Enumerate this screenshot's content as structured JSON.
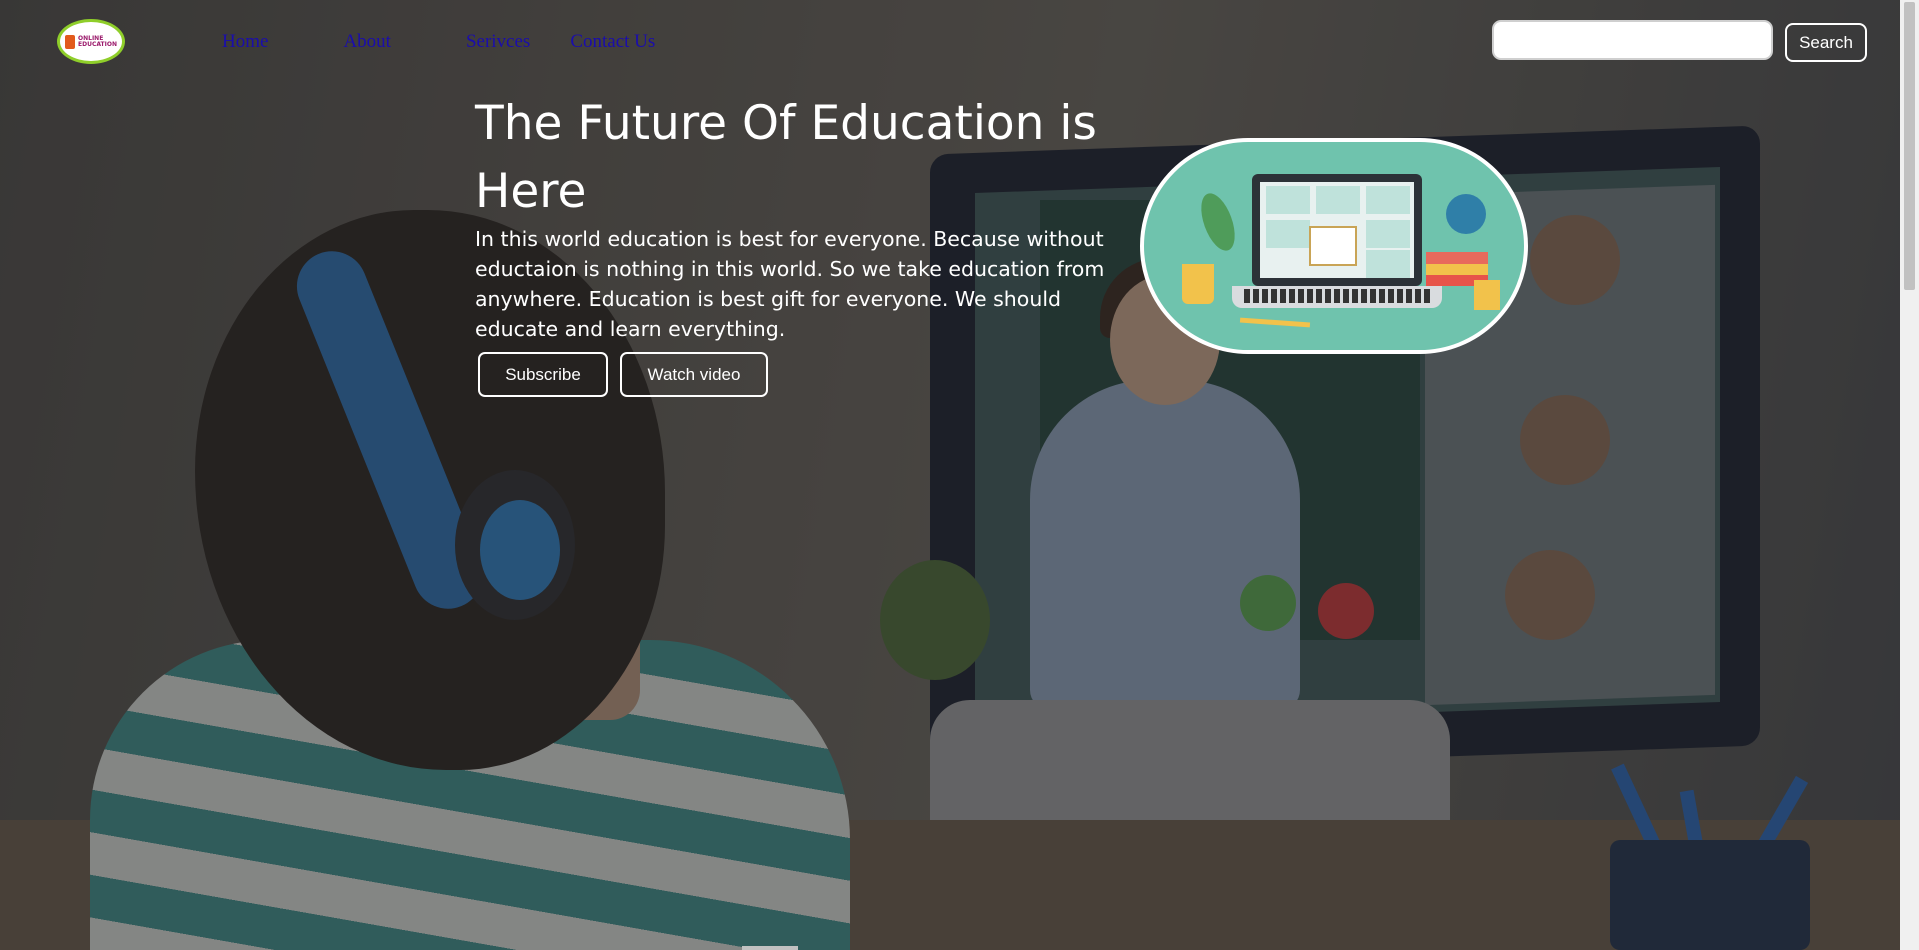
{
  "header": {
    "logo": {
      "text_line1": "ONLINE",
      "text_line2": "EDUCATION",
      "color_ring": "#8fce2a"
    },
    "nav": [
      {
        "label": "Home"
      },
      {
        "label": "About"
      },
      {
        "label": "Serivces"
      },
      {
        "label": "Contact Us"
      }
    ],
    "search": {
      "value": "",
      "placeholder": "",
      "button_label": "Search"
    }
  },
  "hero": {
    "title": "The Future Of Education is Here",
    "text": "In this world education is best for everyone. Because without eductaion is nothing in this world. So we take education from anywhere. Education is best gift for everyone. We should educate and learn everything.",
    "buttons": {
      "subscribe": "Subscribe",
      "watch": "Watch video"
    }
  },
  "colors": {
    "nav_link": "#1a0dab",
    "hero_text": "#ffffff",
    "illustration_bg": "#6fc3ad"
  },
  "icons": [
    "logo-icon",
    "online-class-illustration"
  ]
}
